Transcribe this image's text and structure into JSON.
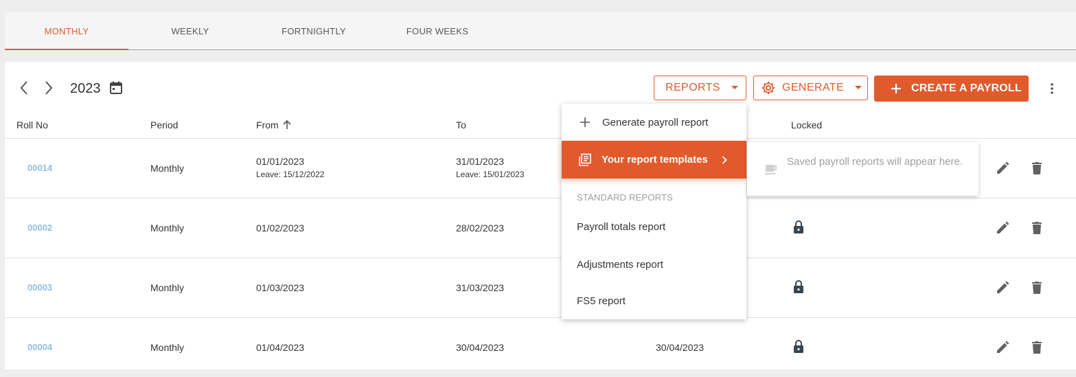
{
  "tabs": [
    "MONTHLY",
    "WEEKLY",
    "FORTNIGHTLY",
    "FOUR WEEKS"
  ],
  "toolbar": {
    "year": "2023",
    "reports_label": "REPORTS",
    "generate_label": "GENERATE",
    "create_label": "CREATE A PAYROLL"
  },
  "table": {
    "headers": [
      "Roll No",
      "Period",
      "From",
      "To",
      "Locked"
    ],
    "rows": [
      {
        "roll": "00014",
        "period": "Monthly",
        "from": "01/01/2023",
        "from_leave": "Leave: 15/12/2022",
        "to": "31/01/2023",
        "to_leave": "Leave: 15/01/2023"
      },
      {
        "roll": "00002",
        "period": "Monthly",
        "from": "01/02/2023",
        "to": "28/02/2023"
      },
      {
        "roll": "00003",
        "period": "Monthly",
        "from": "01/03/2023",
        "to": "31/03/2023"
      },
      {
        "roll": "00004",
        "period": "Monthly",
        "from": "01/04/2023",
        "to": "30/04/2023",
        "pay_date": "30/04/2023"
      }
    ]
  },
  "menu": {
    "generate": "Generate payroll report",
    "templates": "Your report templates",
    "section": "STANDARD REPORTS",
    "items": [
      "Payroll totals report",
      "Adjustments report",
      "FS5 report"
    ]
  },
  "submenu": {
    "empty": "Saved payroll reports will appear here."
  },
  "colors": {
    "accent": "#e05a2b",
    "link": "#90bfe0"
  }
}
